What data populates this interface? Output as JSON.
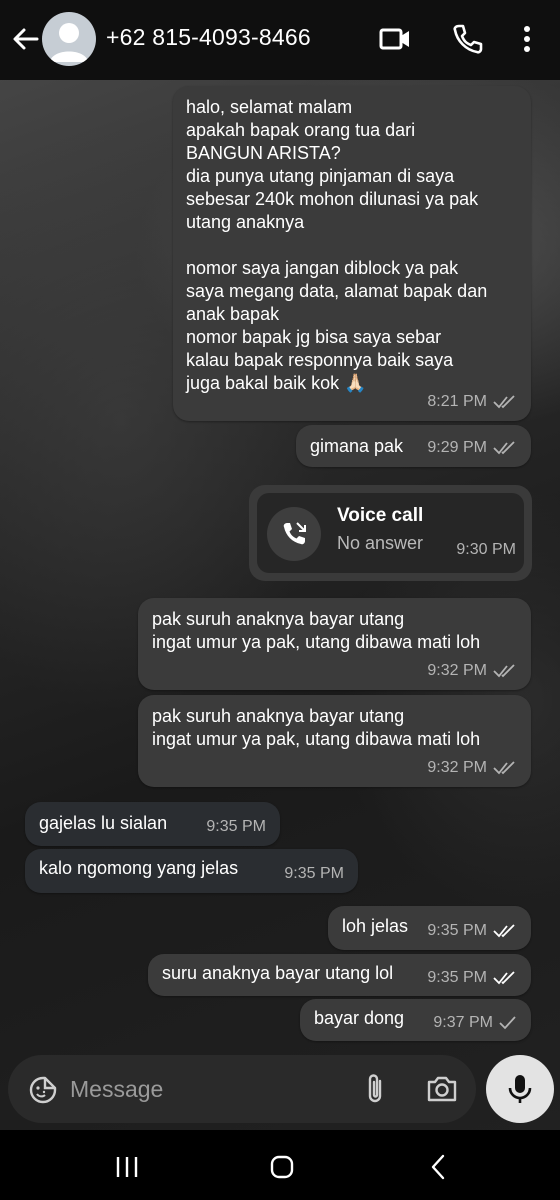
{
  "header": {
    "contact": "+62 815-4093-8466",
    "icons": [
      "back-arrow-icon",
      "video-call-icon",
      "phone-icon",
      "more-vertical-icon"
    ]
  },
  "messages": [
    {
      "direction": "out",
      "text": "halo, selamat malam\napakah bapak orang tua dari\nBANGUN ARISTA?\ndia punya utang pinjaman di saya\nsebesar 240k mohon dilunasi ya pak\nutang anaknya\n\nnomor saya jangan diblock ya pak\nsaya megang data, alamat bapak dan\nanak bapak\nnomor bapak jg bisa saya sebar\nkalau bapak responnya baik saya\njuga bakal baik kok 🙏🏻",
      "time": "8:21 PM",
      "status": "read"
    },
    {
      "direction": "out",
      "text": "gimana pak",
      "time": "9:29 PM",
      "status": "read"
    },
    {
      "direction": "out",
      "text": "pak suruh anaknya bayar utang\ningat umur ya pak, utang dibawa mati loh",
      "time": "9:32 PM",
      "status": "read"
    },
    {
      "direction": "out",
      "text": "pak suruh anaknya bayar utang\ningat umur ya pak, utang dibawa mati loh",
      "time": "9:32 PM",
      "status": "read"
    },
    {
      "direction": "in",
      "text": "gajelas lu sialan",
      "time": "9:35 PM"
    },
    {
      "direction": "in",
      "text": "kalo ngomong yang jelas",
      "time": "9:35 PM"
    },
    {
      "direction": "out",
      "text": "loh jelas",
      "time": "9:35 PM",
      "status": "read"
    },
    {
      "direction": "out",
      "text": "suru anaknya bayar utang lol",
      "time": "9:35 PM",
      "status": "read"
    },
    {
      "direction": "out",
      "text": "bayar dong",
      "time": "9:37 PM",
      "status": "sent"
    }
  ],
  "call": {
    "title": "Voice call",
    "subtitle": "No answer",
    "time": "9:30 PM",
    "icon": "missed-call-icon"
  },
  "composer": {
    "placeholder": "Message",
    "icons": [
      "sticker-icon",
      "attach-icon",
      "camera-icon",
      "mic-icon"
    ]
  },
  "navbar": {
    "icons": [
      "recents-icon",
      "home-icon",
      "back-icon"
    ]
  },
  "colors": {
    "header_bg": "#0f0f0f",
    "bubble_out": "#3b3b3b",
    "bubble_in": "#2a2d31",
    "tick_read": "#b4b4b4"
  }
}
